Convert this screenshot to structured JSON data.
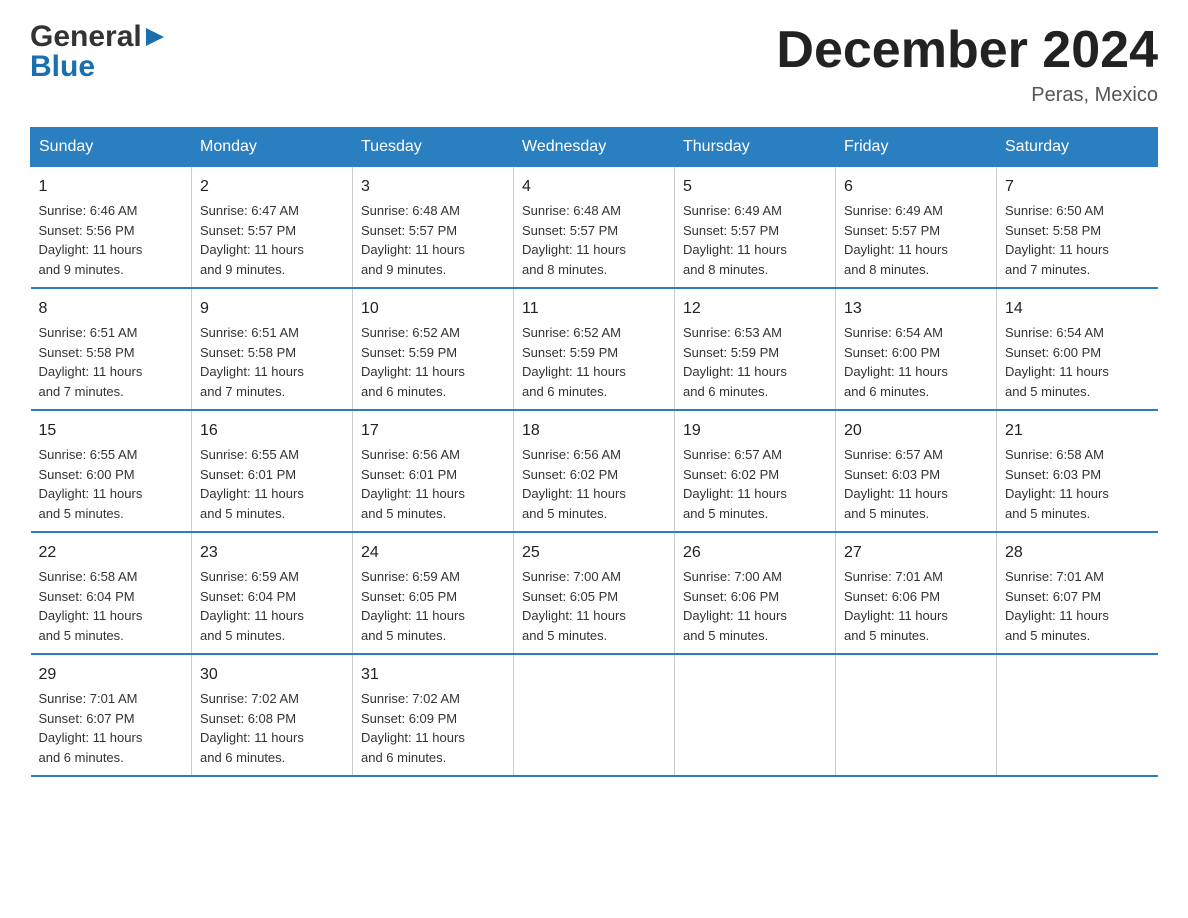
{
  "logo": {
    "line1": "General",
    "line2": "Blue"
  },
  "title": "December 2024",
  "subtitle": "Peras, Mexico",
  "headers": [
    "Sunday",
    "Monday",
    "Tuesday",
    "Wednesday",
    "Thursday",
    "Friday",
    "Saturday"
  ],
  "weeks": [
    [
      {
        "day": "1",
        "info": "Sunrise: 6:46 AM\nSunset: 5:56 PM\nDaylight: 11 hours\nand 9 minutes."
      },
      {
        "day": "2",
        "info": "Sunrise: 6:47 AM\nSunset: 5:57 PM\nDaylight: 11 hours\nand 9 minutes."
      },
      {
        "day": "3",
        "info": "Sunrise: 6:48 AM\nSunset: 5:57 PM\nDaylight: 11 hours\nand 9 minutes."
      },
      {
        "day": "4",
        "info": "Sunrise: 6:48 AM\nSunset: 5:57 PM\nDaylight: 11 hours\nand 8 minutes."
      },
      {
        "day": "5",
        "info": "Sunrise: 6:49 AM\nSunset: 5:57 PM\nDaylight: 11 hours\nand 8 minutes."
      },
      {
        "day": "6",
        "info": "Sunrise: 6:49 AM\nSunset: 5:57 PM\nDaylight: 11 hours\nand 8 minutes."
      },
      {
        "day": "7",
        "info": "Sunrise: 6:50 AM\nSunset: 5:58 PM\nDaylight: 11 hours\nand 7 minutes."
      }
    ],
    [
      {
        "day": "8",
        "info": "Sunrise: 6:51 AM\nSunset: 5:58 PM\nDaylight: 11 hours\nand 7 minutes."
      },
      {
        "day": "9",
        "info": "Sunrise: 6:51 AM\nSunset: 5:58 PM\nDaylight: 11 hours\nand 7 minutes."
      },
      {
        "day": "10",
        "info": "Sunrise: 6:52 AM\nSunset: 5:59 PM\nDaylight: 11 hours\nand 6 minutes."
      },
      {
        "day": "11",
        "info": "Sunrise: 6:52 AM\nSunset: 5:59 PM\nDaylight: 11 hours\nand 6 minutes."
      },
      {
        "day": "12",
        "info": "Sunrise: 6:53 AM\nSunset: 5:59 PM\nDaylight: 11 hours\nand 6 minutes."
      },
      {
        "day": "13",
        "info": "Sunrise: 6:54 AM\nSunset: 6:00 PM\nDaylight: 11 hours\nand 6 minutes."
      },
      {
        "day": "14",
        "info": "Sunrise: 6:54 AM\nSunset: 6:00 PM\nDaylight: 11 hours\nand 5 minutes."
      }
    ],
    [
      {
        "day": "15",
        "info": "Sunrise: 6:55 AM\nSunset: 6:00 PM\nDaylight: 11 hours\nand 5 minutes."
      },
      {
        "day": "16",
        "info": "Sunrise: 6:55 AM\nSunset: 6:01 PM\nDaylight: 11 hours\nand 5 minutes."
      },
      {
        "day": "17",
        "info": "Sunrise: 6:56 AM\nSunset: 6:01 PM\nDaylight: 11 hours\nand 5 minutes."
      },
      {
        "day": "18",
        "info": "Sunrise: 6:56 AM\nSunset: 6:02 PM\nDaylight: 11 hours\nand 5 minutes."
      },
      {
        "day": "19",
        "info": "Sunrise: 6:57 AM\nSunset: 6:02 PM\nDaylight: 11 hours\nand 5 minutes."
      },
      {
        "day": "20",
        "info": "Sunrise: 6:57 AM\nSunset: 6:03 PM\nDaylight: 11 hours\nand 5 minutes."
      },
      {
        "day": "21",
        "info": "Sunrise: 6:58 AM\nSunset: 6:03 PM\nDaylight: 11 hours\nand 5 minutes."
      }
    ],
    [
      {
        "day": "22",
        "info": "Sunrise: 6:58 AM\nSunset: 6:04 PM\nDaylight: 11 hours\nand 5 minutes."
      },
      {
        "day": "23",
        "info": "Sunrise: 6:59 AM\nSunset: 6:04 PM\nDaylight: 11 hours\nand 5 minutes."
      },
      {
        "day": "24",
        "info": "Sunrise: 6:59 AM\nSunset: 6:05 PM\nDaylight: 11 hours\nand 5 minutes."
      },
      {
        "day": "25",
        "info": "Sunrise: 7:00 AM\nSunset: 6:05 PM\nDaylight: 11 hours\nand 5 minutes."
      },
      {
        "day": "26",
        "info": "Sunrise: 7:00 AM\nSunset: 6:06 PM\nDaylight: 11 hours\nand 5 minutes."
      },
      {
        "day": "27",
        "info": "Sunrise: 7:01 AM\nSunset: 6:06 PM\nDaylight: 11 hours\nand 5 minutes."
      },
      {
        "day": "28",
        "info": "Sunrise: 7:01 AM\nSunset: 6:07 PM\nDaylight: 11 hours\nand 5 minutes."
      }
    ],
    [
      {
        "day": "29",
        "info": "Sunrise: 7:01 AM\nSunset: 6:07 PM\nDaylight: 11 hours\nand 6 minutes."
      },
      {
        "day": "30",
        "info": "Sunrise: 7:02 AM\nSunset: 6:08 PM\nDaylight: 11 hours\nand 6 minutes."
      },
      {
        "day": "31",
        "info": "Sunrise: 7:02 AM\nSunset: 6:09 PM\nDaylight: 11 hours\nand 6 minutes."
      },
      {
        "day": "",
        "info": ""
      },
      {
        "day": "",
        "info": ""
      },
      {
        "day": "",
        "info": ""
      },
      {
        "day": "",
        "info": ""
      }
    ]
  ]
}
